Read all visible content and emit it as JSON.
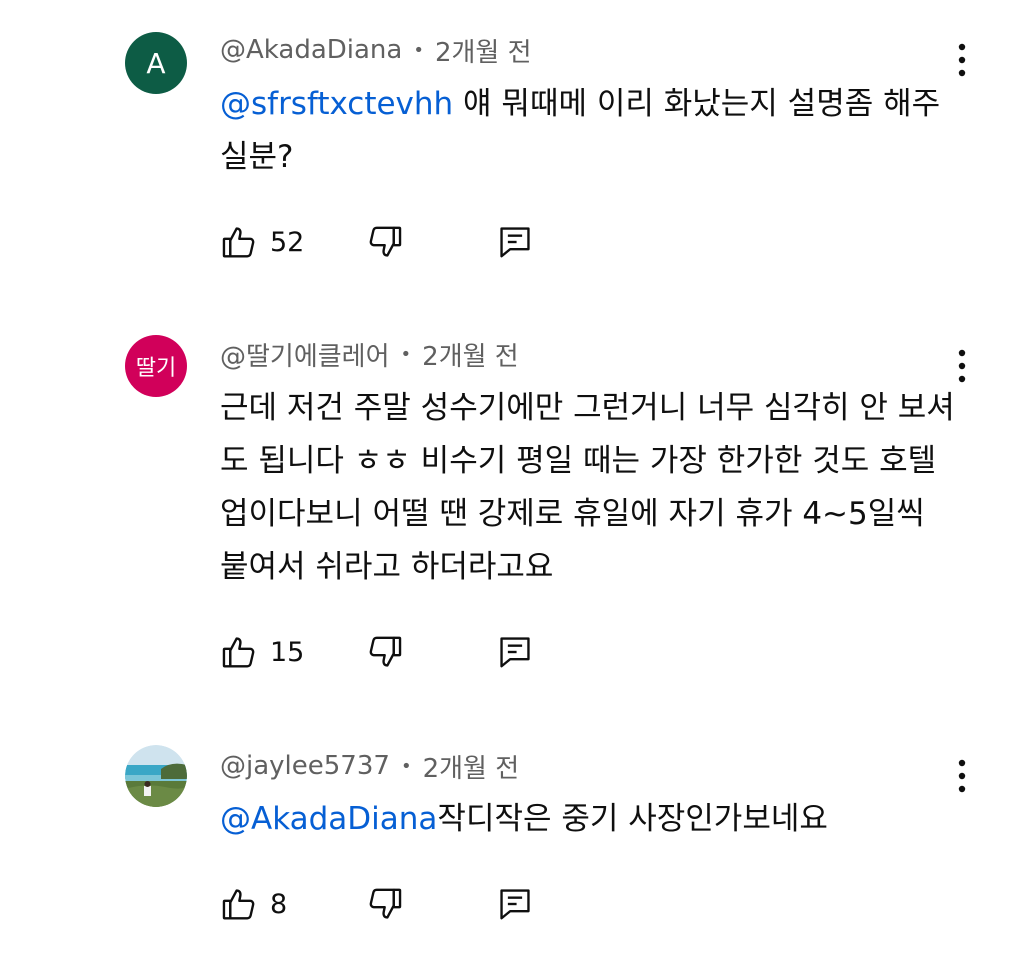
{
  "comments": [
    {
      "avatar": {
        "type": "letter",
        "text": "A",
        "bg": "#0d5c45"
      },
      "author": "@AkadaDiana",
      "separator": "•",
      "time": "2개월 전",
      "mention": "@sfrsftxctevhh",
      "text": " 얘 뭐때메 이리 화났는지 설명좀 해주실분?",
      "likes": "52"
    },
    {
      "avatar": {
        "type": "text",
        "text": "딸기",
        "bg": "#d1005a"
      },
      "author": "@딸기에클레어",
      "separator": "•",
      "time": "2개월 전",
      "mention": "",
      "text": "근데 저건 주말 성수기에만 그런거니 너무 심각히 안 보셔도 됩니다 ㅎㅎ 비수기 평일 때는 가장 한가한 것도 호텔업이다보니 어떨 땐 강제로 휴일에 자기 휴가 4~5일씩 붙여서 쉬라고 하더라고요",
      "likes": "15"
    },
    {
      "avatar": {
        "type": "image",
        "text": "",
        "bg": "#5aa8c9"
      },
      "author": "@jaylee5737",
      "separator": "•",
      "time": "2개월 전",
      "mention": "@AkadaDiana",
      "text": "작디작은 중기 사장인가보네요",
      "likes": "8"
    }
  ],
  "icons": {
    "like": "thumbs-up-icon",
    "dislike": "thumbs-down-icon",
    "reply": "reply-icon",
    "menu": "more-vertical-icon"
  },
  "colors": {
    "mention": "#065fd4",
    "meta": "#606060",
    "text": "#0f0f0f"
  }
}
